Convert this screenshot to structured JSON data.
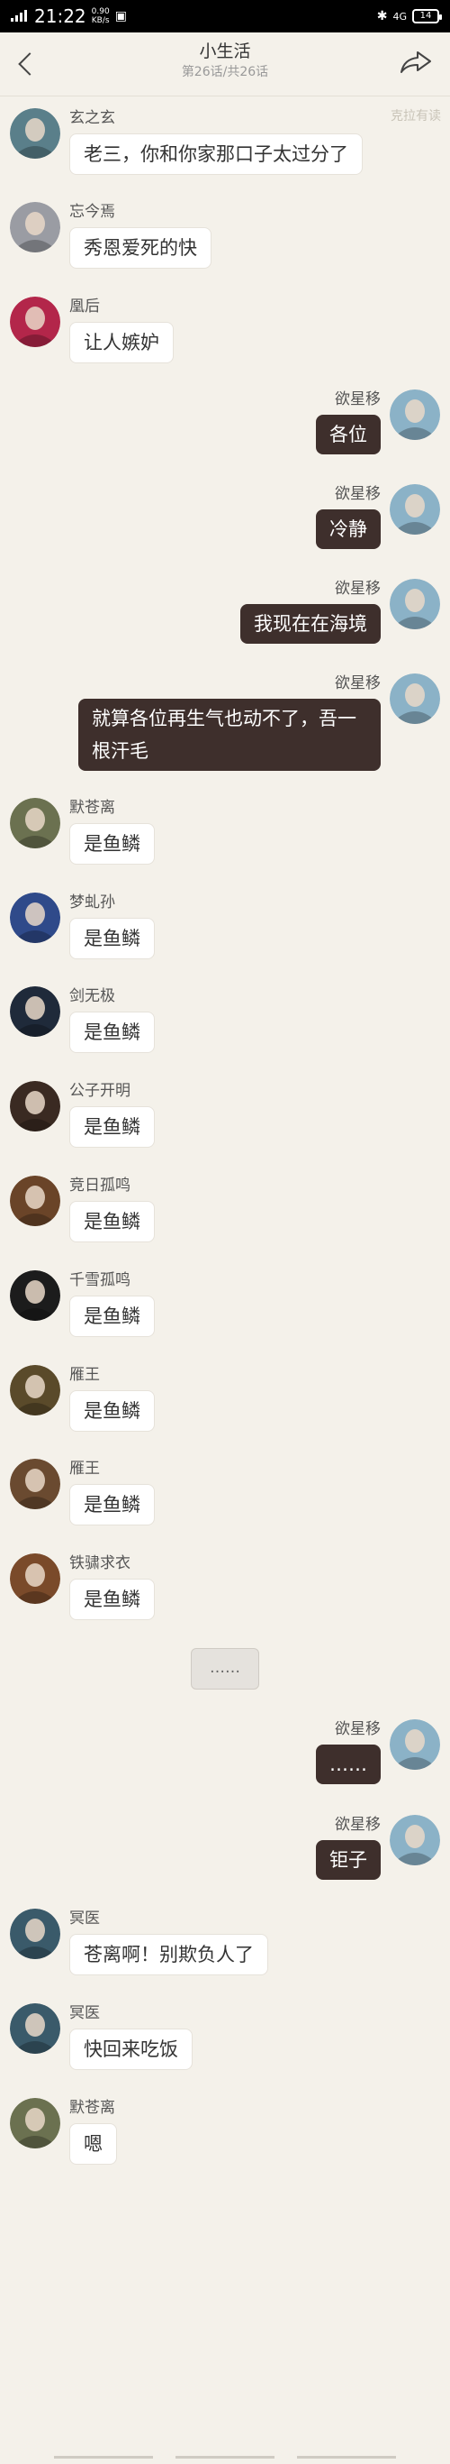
{
  "status_bar": {
    "network": "4G",
    "time": "21:22",
    "speed_value": "0.90",
    "speed_unit": "KB/s",
    "right_network": "4G",
    "battery": "14"
  },
  "header": {
    "title": "小生活",
    "subtitle": "第26话/共26话",
    "watermark": "克拉有读"
  },
  "messages": [
    {
      "side": "left",
      "name": "玄之玄",
      "text": "老三，你和你家那口子太过分了",
      "avatar_color": "#5a7f8a"
    },
    {
      "side": "left",
      "name": "忘今焉",
      "text": "秀恩爱死的快",
      "avatar_color": "#9a9ca3"
    },
    {
      "side": "left",
      "name": "凰后",
      "text": "让人嫉妒",
      "avatar_color": "#b3264a"
    },
    {
      "side": "right",
      "name": "欲星移",
      "text": "各位",
      "avatar_color": "#8bb2c7"
    },
    {
      "side": "right",
      "name": "欲星移",
      "text": "冷静",
      "avatar_color": "#8bb2c7"
    },
    {
      "side": "right",
      "name": "欲星移",
      "text": "我现在在海境",
      "avatar_color": "#8bb2c7"
    },
    {
      "side": "right",
      "name": "欲星移",
      "text": "就算各位再生气也动不了，吾一根汗毛",
      "avatar_color": "#8bb2c7"
    },
    {
      "side": "left",
      "name": "默苍离",
      "text": "是鱼鳞",
      "avatar_color": "#6b7150"
    },
    {
      "side": "left",
      "name": "梦虬孙",
      "text": "是鱼鳞",
      "avatar_color": "#2f4a8a"
    },
    {
      "side": "left",
      "name": "剑无极",
      "text": "是鱼鳞",
      "avatar_color": "#1f2a3a"
    },
    {
      "side": "left",
      "name": "公子开明",
      "text": "是鱼鳞",
      "avatar_color": "#3a2a22"
    },
    {
      "side": "left",
      "name": "竞日孤鸣",
      "text": "是鱼鳞",
      "avatar_color": "#6a4428"
    },
    {
      "side": "left",
      "name": "千雪孤鸣",
      "text": "是鱼鳞",
      "avatar_color": "#1c1c1c"
    },
    {
      "side": "left",
      "name": "雁王",
      "text": "是鱼鳞",
      "avatar_color": "#5a4a2a"
    },
    {
      "side": "left",
      "name": "雁王",
      "text": "是鱼鳞",
      "avatar_color": "#6a4a30"
    },
    {
      "side": "left",
      "name": "铁骕求衣",
      "text": "是鱼鳞",
      "avatar_color": "#7a4a2a"
    },
    {
      "side": "right",
      "name": "欲星移",
      "text": "……",
      "avatar_color": "#8bb2c7"
    },
    {
      "side": "right",
      "name": "欲星移",
      "text": "钜子",
      "avatar_color": "#8bb2c7"
    },
    {
      "side": "left",
      "name": "冥医",
      "text": "苍离啊！别欺负人了",
      "avatar_color": "#3a5a6a"
    },
    {
      "side": "left",
      "name": "冥医",
      "text": "快回来吃饭",
      "avatar_color": "#3a5a6a"
    },
    {
      "side": "left",
      "name": "默苍离",
      "text": "嗯",
      "avatar_color": "#6b7150"
    }
  ],
  "separator": {
    "text": "……"
  }
}
